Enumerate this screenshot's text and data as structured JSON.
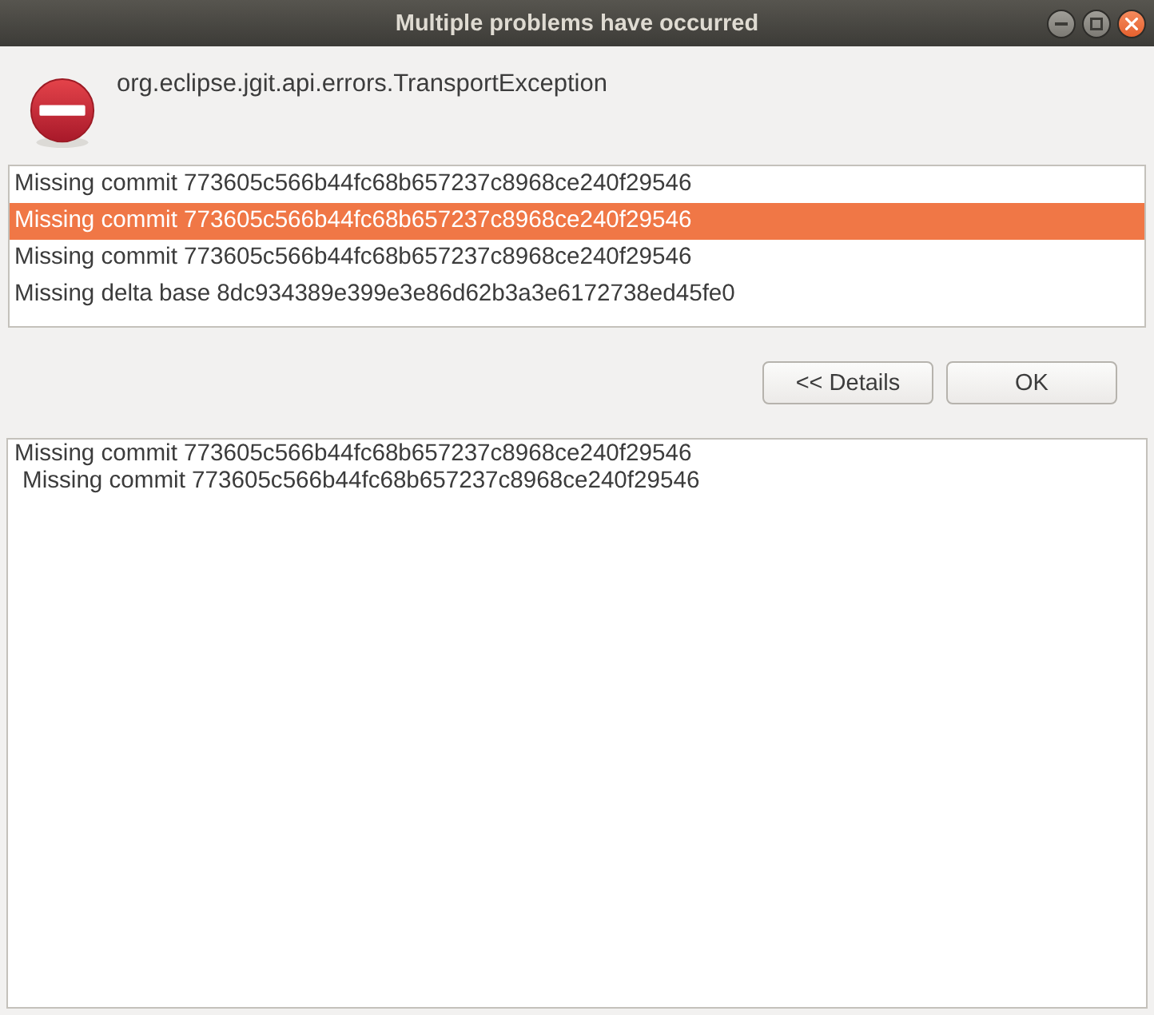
{
  "window": {
    "title": "Multiple problems have occurred"
  },
  "message": {
    "text": "org.eclipse.jgit.api.errors.TransportException"
  },
  "problems": [
    {
      "text": "Missing commit 773605c566b44fc68b657237c8968ce240f29546",
      "selected": false
    },
    {
      "text": "Missing commit 773605c566b44fc68b657237c8968ce240f29546",
      "selected": true
    },
    {
      "text": "Missing commit 773605c566b44fc68b657237c8968ce240f29546",
      "selected": false
    },
    {
      "text": "Missing delta base 8dc934389e399e3e86d62b3a3e6172738ed45fe0",
      "selected": false
    }
  ],
  "buttons": [
    {
      "label": "<< Details"
    },
    {
      "label": "OK"
    }
  ],
  "details": {
    "lines": [
      {
        "text": "Missing commit 773605c566b44fc68b657237c8968ce240f29546",
        "children": [
          {
            "text": "Missing commit 773605c566b44fc68b657237c8968ce240f29546"
          }
        ]
      }
    ]
  }
}
